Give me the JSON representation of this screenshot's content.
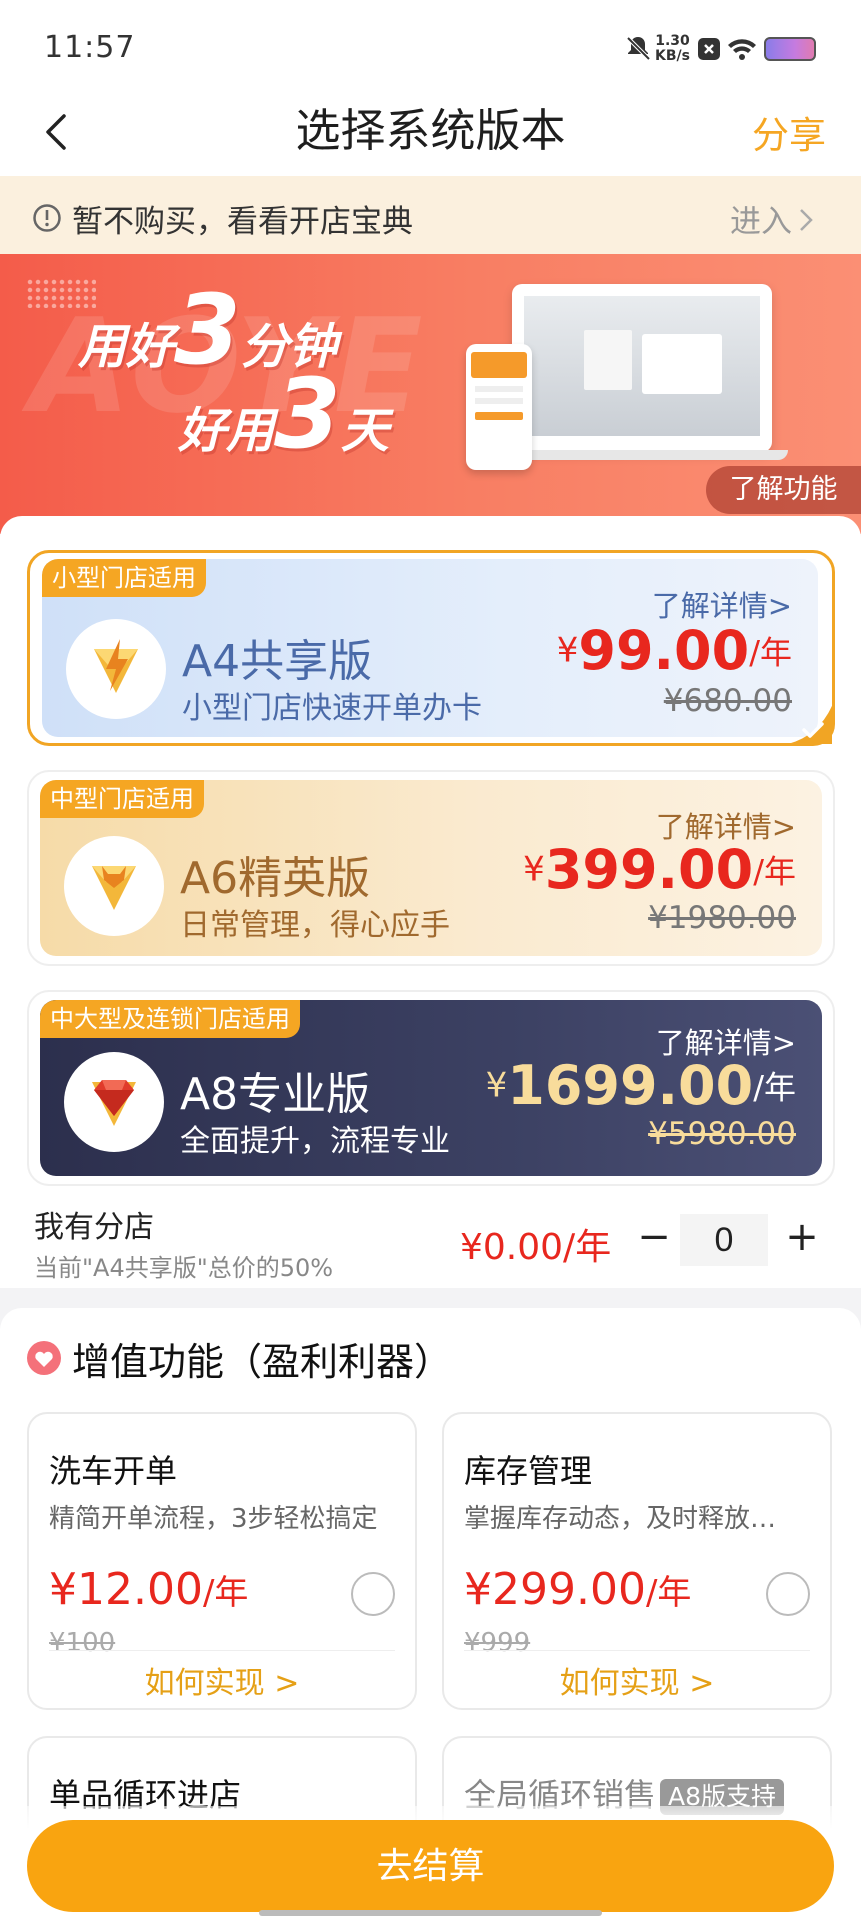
{
  "status_bar": {
    "time": "11:57",
    "speed_value": "1.30",
    "speed_unit": "KB/s"
  },
  "nav": {
    "title": "选择系统版本",
    "share": "分享"
  },
  "notice": {
    "text": "暂不购买，看看开店宝典",
    "enter": "进入"
  },
  "banner": {
    "slogan_line1_a": "用好",
    "slogan_line1_num": "3",
    "slogan_line1_b": "分钟",
    "slogan_line2_a": "好用",
    "slogan_line2_num": "3",
    "slogan_line2_b": "天",
    "watermark": "AOYE",
    "learn_button": "了解功能"
  },
  "plans": [
    {
      "tag": "小型门店适用",
      "name": "A4共享版",
      "desc": "小型门店快速开单办卡",
      "detail_link": "了解详情>",
      "currency": "¥",
      "price": "99.00",
      "unit": "/年",
      "original_price": "¥680.00",
      "selected": true
    },
    {
      "tag": "中型门店适用",
      "name": "A6精英版",
      "desc": "日常管理，得心应手",
      "detail_link": "了解详情>",
      "currency": "¥",
      "price": "399.00",
      "unit": "/年",
      "original_price": "¥1980.00",
      "selected": false
    },
    {
      "tag": "中大型及连锁门店适用",
      "name": "A8专业版",
      "desc": "全面提升，流程专业",
      "detail_link": "了解详情>",
      "currency": "¥",
      "price": "1699.00",
      "unit": "/年",
      "original_price": "¥5980.00",
      "selected": false
    }
  ],
  "branch": {
    "label": "我有分店",
    "desc": "当前\"A4共享版\"总价的50%",
    "price": "¥0.00/年",
    "minus": "−",
    "plus": "+",
    "qty": "0"
  },
  "value_added": {
    "title": "增值功能（盈利利器）",
    "features": [
      {
        "name": "洗车开单",
        "desc": "精简开单流程，3步轻松搞定",
        "price": "¥12.00",
        "unit": "/年",
        "original": "¥100",
        "how": "如何实现 >"
      },
      {
        "name": "库存管理",
        "desc": "掌握库存动态，及时释放…",
        "price": "¥299.00",
        "unit": "/年",
        "original": "¥999",
        "how": "如何实现 >"
      },
      {
        "name": "单品循环进店"
      },
      {
        "name": "全局循环销售",
        "badge": "A8版支持"
      }
    ]
  },
  "checkout": {
    "label": "去结算"
  },
  "colors": {
    "accent": "#f9a410",
    "price_red": "#e8271e",
    "share_orange": "#f5a623",
    "navy": "#333a5c"
  }
}
